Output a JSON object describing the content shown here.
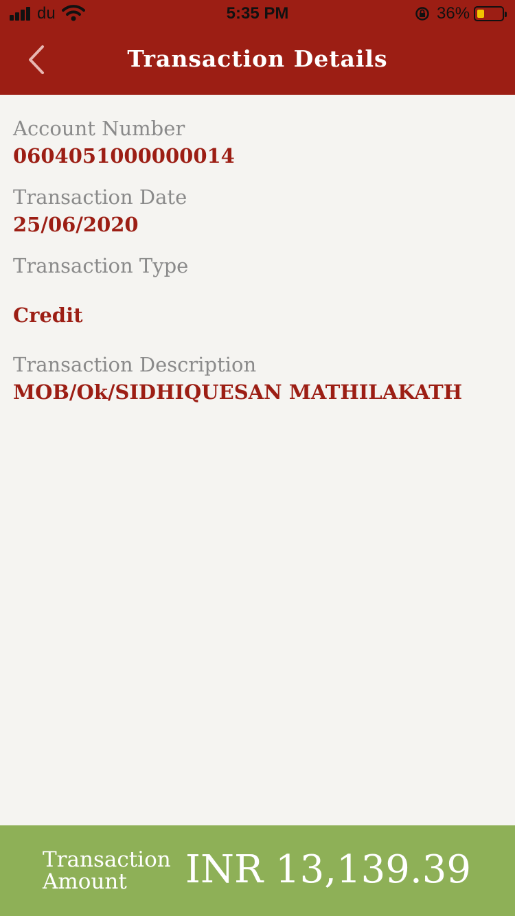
{
  "status_bar": {
    "carrier": "du",
    "time": "5:35 PM",
    "battery_percent": "36%",
    "battery_level": 0.36
  },
  "nav": {
    "title": "Transaction Details",
    "back_icon": "chevron-left-icon"
  },
  "details": {
    "account_number_label": "Account Number",
    "account_number": "0604051000000014",
    "transaction_date_label": "Transaction Date",
    "transaction_date": "25/06/2020",
    "transaction_type_label": "Transaction Type",
    "transaction_type": "Credit",
    "description_label": "Transaction Description",
    "description": "MOB/Ok/SIDHIQUESAN MATHILAKATH"
  },
  "footer": {
    "amount_label_line1": "Transaction",
    "amount_label_line2": "Amount",
    "amount": "INR 13,139.39"
  },
  "colors": {
    "header": "#9c1e14",
    "accent_text": "#9c1e14",
    "label_text": "#8a8a8a",
    "footer": "#8eb057",
    "background": "#f5f4f1"
  }
}
